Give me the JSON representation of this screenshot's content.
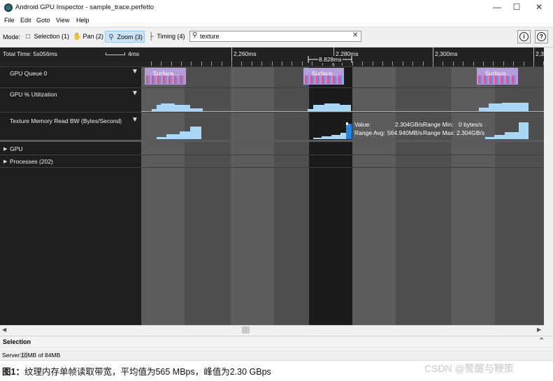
{
  "window": {
    "title": "Android GPU Inspector - sample_trace.perfetto",
    "minimize_icon": "minimize-icon",
    "maximize_icon": "maximize-icon",
    "close_icon": "close-icon"
  },
  "menu": [
    "File",
    "Edit",
    "Goto",
    "View",
    "Help"
  ],
  "toolbar": {
    "mode_label": "Mode:",
    "modes": [
      {
        "label": "Selection (1)",
        "icon": "selection-icon"
      },
      {
        "label": "Pan (2)",
        "icon": "hand-icon"
      },
      {
        "label": "Zoom (3)",
        "icon": "zoom-icon",
        "active": true
      },
      {
        "label": "Timing (4)",
        "icon": "timing-icon"
      }
    ],
    "search": {
      "value": "texture",
      "icon": "search-icon",
      "clear_icon": "clear-icon"
    },
    "info_icon": "info-icon",
    "help_icon": "help-icon"
  },
  "ruler": {
    "total_time": "Total Time: 5s056ms",
    "scale_label": "4ms",
    "ticks": [
      "2,260ms",
      "2,280ms",
      "2,300ms",
      "2,3"
    ],
    "selection_span": "8.828ms"
  },
  "tracks": [
    {
      "name": "GPU Queue 0",
      "slices": [
        "Surface...",
        "Surface...",
        "Surface..."
      ]
    },
    {
      "name": "GPU % Utilization"
    },
    {
      "name": "Texture Memory Read BW (Bytes/Second)"
    }
  ],
  "tooltip": {
    "value_label": "Value:",
    "value": "2.304GB/s",
    "range_min_label": "Range Min:",
    "range_min": "0 bytes/s",
    "range_avg_label": "Range Avg:",
    "range_avg": "564.940MB/s",
    "range_max_label": "Range Max:",
    "range_max": "2.304GB/s"
  },
  "groups": [
    {
      "label": "GPU"
    },
    {
      "label": "Processes (202)"
    }
  ],
  "selection_panel": {
    "title": "Selection"
  },
  "status": {
    "server_label": "Server:",
    "server_hl": "10",
    "server_rest": "MB of 84MB"
  },
  "caption": {
    "prefix": "图1：",
    "text": "纹理内存单帧读取带宽，平均值为565 MBps，峰值为2.30 GBps"
  },
  "watermark": "CSDN @警醒与鞭策",
  "accent_colors": {
    "slice": "#b39ddb",
    "chart_fill": "#a8d8f5",
    "selection_bg": "#cce4f7"
  }
}
